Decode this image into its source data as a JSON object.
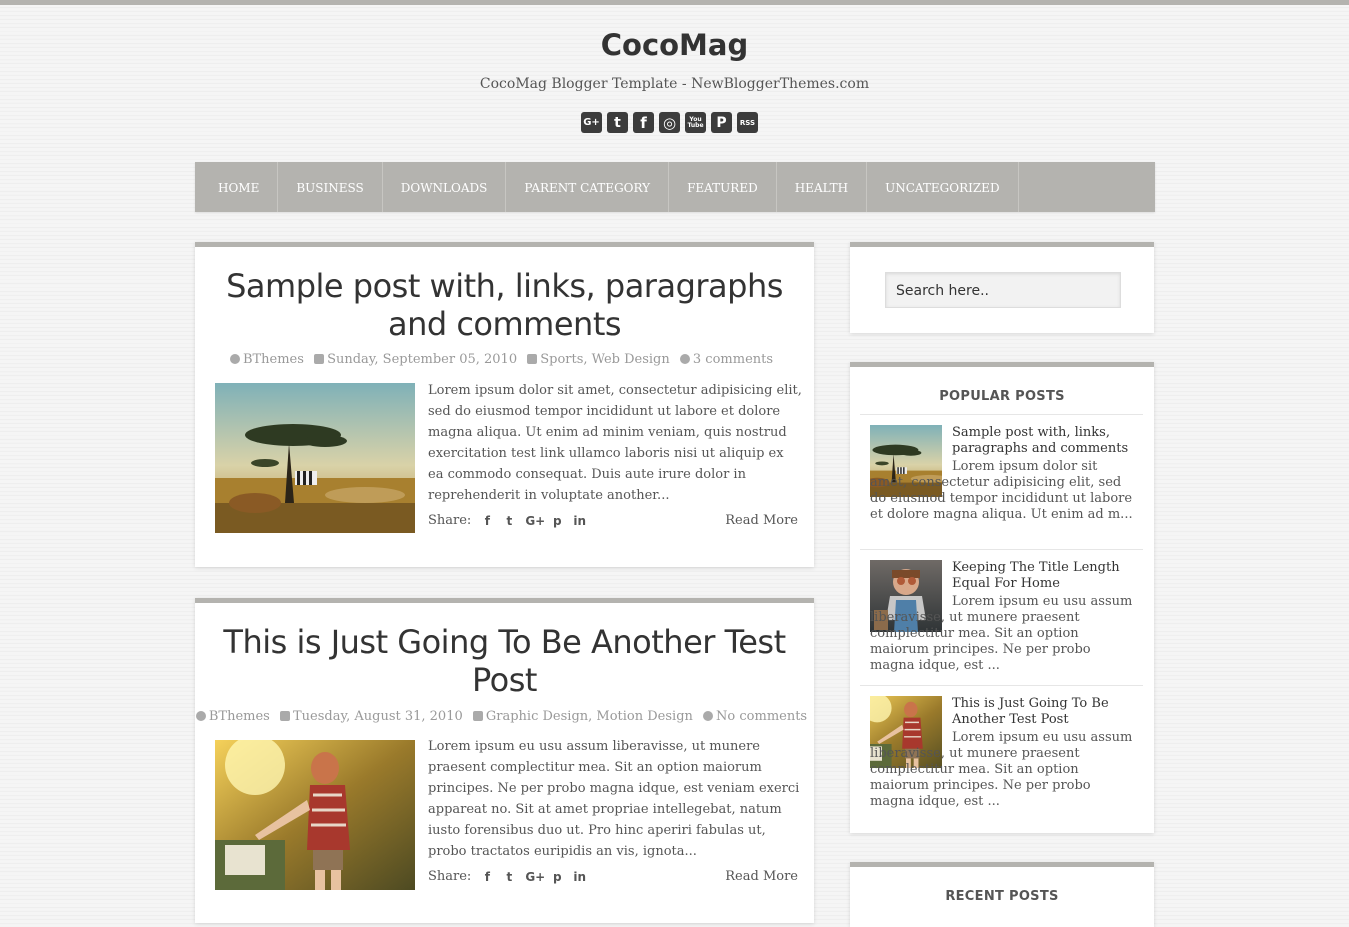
{
  "header": {
    "title": "CocoMag",
    "description": "CocoMag Blogger Template - NewBloggerThemes.com",
    "social": [
      "G+",
      "t",
      "f",
      "◎",
      "You Tube",
      "P",
      "RSS"
    ]
  },
  "nav": {
    "items": [
      "HOME",
      "BUSINESS",
      "DOWNLOADS",
      "PARENT CATEGORY",
      "FEATURED",
      "HEALTH",
      "UNCATEGORIZED"
    ]
  },
  "posts": [
    {
      "title": "Sample post with, links, paragraphs and comments",
      "author": "BThemes",
      "date": "Sunday, September 05, 2010",
      "categories": "Sports, Web Design",
      "comments": "3 comments",
      "excerpt": "Lorem ipsum dolor sit amet, consectetur adipisicing elit, sed do eiusmod tempor incididunt ut labore et dolore magna aliqua. Ut enim ad minim veniam, quis nostrud exercitation test link ullamco laboris nisi ut aliquip ex ea commodo consequat. Duis aute irure dolor in reprehenderit in voluptate another...",
      "share_label": "Share:",
      "read_more": "Read More"
    },
    {
      "title": "This is Just Going To Be Another Test Post",
      "author": "BThemes",
      "date": "Tuesday, August 31, 2010",
      "categories": "Graphic Design, Motion Design",
      "comments": "No comments",
      "excerpt": "Lorem ipsum eu usu assum liberavisse, ut munere praesent complectitur mea. Sit an option maiorum principes. Ne per probo magna idque, est veniam exerci appareat no. Sit at amet propriae intellegebat, natum iusto forensibus duo ut. Pro hinc aperiri fabulas ut, probo tractatos euripidis an vis, ignota...",
      "share_label": "Share:",
      "read_more": "Read More"
    }
  ],
  "sidebar": {
    "search_placeholder": "Search here..",
    "popular_title": "POPULAR POSTS",
    "popular": [
      {
        "title": "Sample post with, links, paragraphs and comments",
        "snippet": "Lorem ipsum dolor sit amet, consectetur adipisicing elit, sed do eiusmod tempor incididunt ut labore et dolore magna aliqua. Ut enim ad m..."
      },
      {
        "title": "Keeping The Title Length Equal For Home",
        "snippet": "Lorem ipsum eu usu assum liberavisse, ut munere praesent complectitur mea. Sit an option maiorum principes. Ne per probo magna idque, est ..."
      },
      {
        "title": "This is Just Going To Be Another Test Post",
        "snippet": "Lorem ipsum eu usu assum liberavisse, ut munere praesent complectitur mea. Sit an option maiorum principes. Ne per probo magna idque, est ..."
      }
    ],
    "recent_title": "RECENT POSTS"
  },
  "colors": {
    "accent": "#b4b3af",
    "background": "#f3f3f3"
  }
}
